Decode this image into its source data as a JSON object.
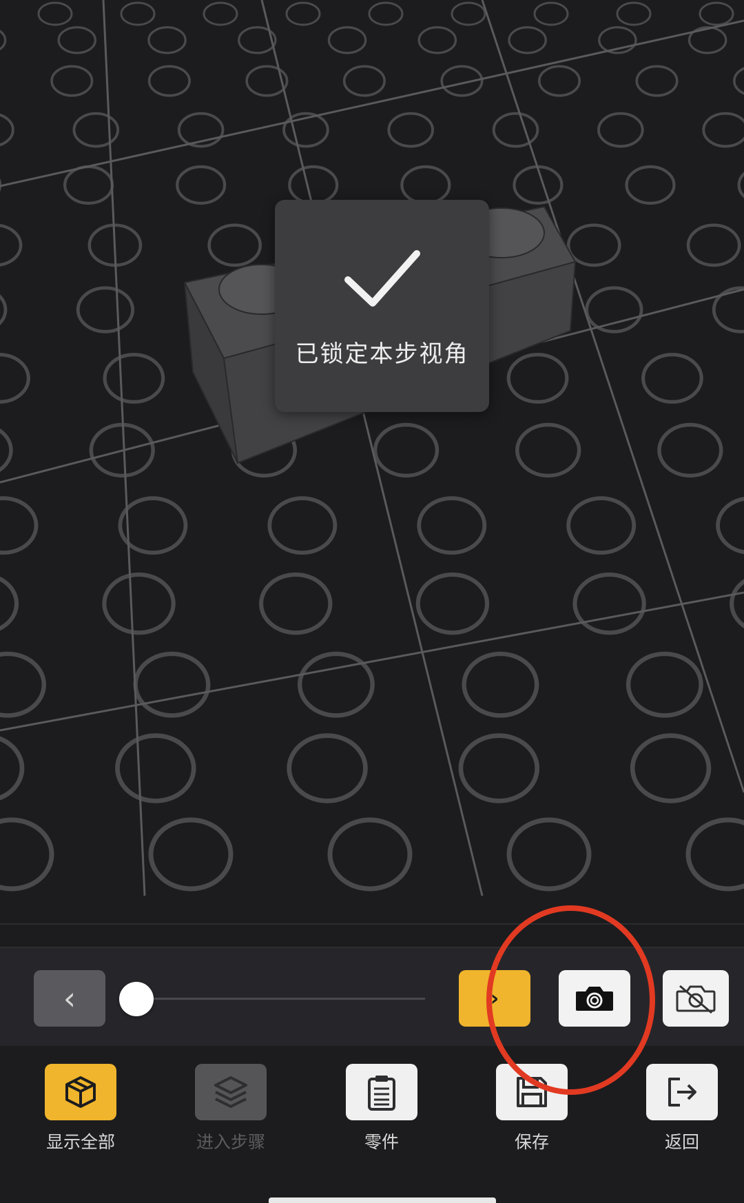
{
  "toast": {
    "message": "已锁定本步视角"
  },
  "stepper": {
    "prev_label": "‹",
    "next_label": "›",
    "progress": 0
  },
  "toolbar": {
    "items": [
      {
        "label": "显示全部",
        "icon": "cube-icon",
        "state": "active"
      },
      {
        "label": "进入步骤",
        "icon": "layers-icon",
        "state": "disabled"
      },
      {
        "label": "零件",
        "icon": "clipboard-icon",
        "state": "normal"
      },
      {
        "label": "保存",
        "icon": "save-icon",
        "state": "normal"
      },
      {
        "label": "返回",
        "icon": "exit-icon",
        "state": "normal"
      }
    ]
  },
  "colors": {
    "accent": "#f0b52c",
    "background": "#1c1c1e",
    "annotation": "#e23a22"
  }
}
